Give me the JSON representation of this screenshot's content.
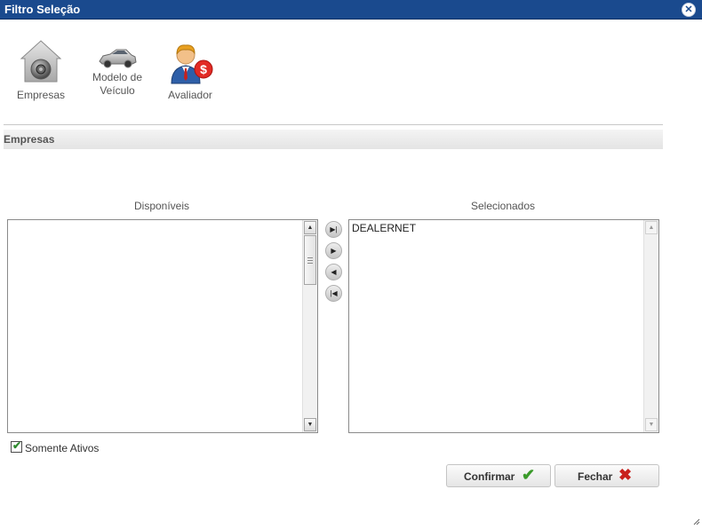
{
  "window": {
    "title": "Filtro Seleção",
    "close_icon": "close-circle-icon"
  },
  "toolbar": {
    "items": [
      {
        "label": "Empresas",
        "icon": "vault-house-icon"
      },
      {
        "label_line1": "Modelo de",
        "label_line2": "Veículo",
        "icon": "car-icon"
      },
      {
        "label": "Avaliador",
        "icon": "appraiser-dollar-icon"
      }
    ]
  },
  "section": {
    "title": "Empresas"
  },
  "available": {
    "title": "Disponíveis",
    "items": []
  },
  "selected": {
    "title": "Selecionados",
    "items": [
      "DEALERNET"
    ]
  },
  "move_buttons": [
    "move-all-right-icon",
    "move-right-icon",
    "move-left-icon",
    "move-all-left-icon"
  ],
  "filter": {
    "active_only_label": "Somente Ativos",
    "active_only_checked": true
  },
  "actions": {
    "confirm_label": "Confirmar",
    "close_label": "Fechar"
  },
  "colors": {
    "titlebar": "#1a4a8e",
    "confirm_check": "#3a9a2a",
    "close_x": "#c8201c"
  }
}
